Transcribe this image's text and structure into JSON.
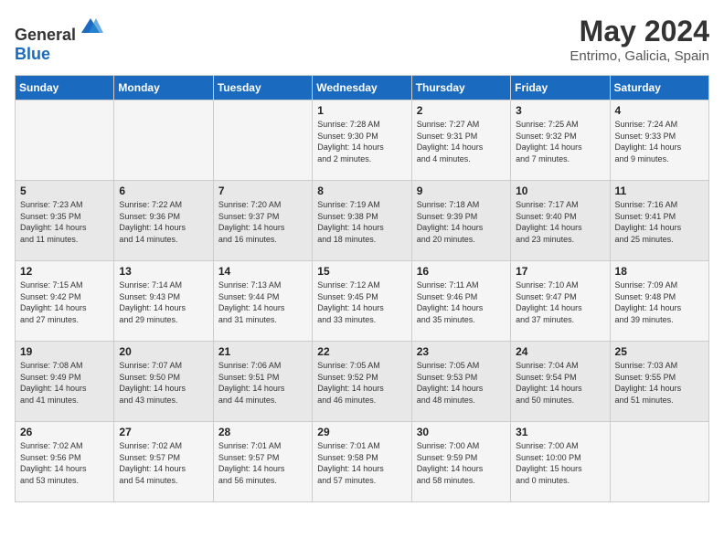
{
  "header": {
    "logo_general": "General",
    "logo_blue": "Blue",
    "month": "May 2024",
    "location": "Entrimo, Galicia, Spain"
  },
  "days_of_week": [
    "Sunday",
    "Monday",
    "Tuesday",
    "Wednesday",
    "Thursday",
    "Friday",
    "Saturday"
  ],
  "weeks": [
    [
      {
        "day": "",
        "info": ""
      },
      {
        "day": "",
        "info": ""
      },
      {
        "day": "",
        "info": ""
      },
      {
        "day": "1",
        "info": "Sunrise: 7:28 AM\nSunset: 9:30 PM\nDaylight: 14 hours\nand 2 minutes."
      },
      {
        "day": "2",
        "info": "Sunrise: 7:27 AM\nSunset: 9:31 PM\nDaylight: 14 hours\nand 4 minutes."
      },
      {
        "day": "3",
        "info": "Sunrise: 7:25 AM\nSunset: 9:32 PM\nDaylight: 14 hours\nand 7 minutes."
      },
      {
        "day": "4",
        "info": "Sunrise: 7:24 AM\nSunset: 9:33 PM\nDaylight: 14 hours\nand 9 minutes."
      }
    ],
    [
      {
        "day": "5",
        "info": "Sunrise: 7:23 AM\nSunset: 9:35 PM\nDaylight: 14 hours\nand 11 minutes."
      },
      {
        "day": "6",
        "info": "Sunrise: 7:22 AM\nSunset: 9:36 PM\nDaylight: 14 hours\nand 14 minutes."
      },
      {
        "day": "7",
        "info": "Sunrise: 7:20 AM\nSunset: 9:37 PM\nDaylight: 14 hours\nand 16 minutes."
      },
      {
        "day": "8",
        "info": "Sunrise: 7:19 AM\nSunset: 9:38 PM\nDaylight: 14 hours\nand 18 minutes."
      },
      {
        "day": "9",
        "info": "Sunrise: 7:18 AM\nSunset: 9:39 PM\nDaylight: 14 hours\nand 20 minutes."
      },
      {
        "day": "10",
        "info": "Sunrise: 7:17 AM\nSunset: 9:40 PM\nDaylight: 14 hours\nand 23 minutes."
      },
      {
        "day": "11",
        "info": "Sunrise: 7:16 AM\nSunset: 9:41 PM\nDaylight: 14 hours\nand 25 minutes."
      }
    ],
    [
      {
        "day": "12",
        "info": "Sunrise: 7:15 AM\nSunset: 9:42 PM\nDaylight: 14 hours\nand 27 minutes."
      },
      {
        "day": "13",
        "info": "Sunrise: 7:14 AM\nSunset: 9:43 PM\nDaylight: 14 hours\nand 29 minutes."
      },
      {
        "day": "14",
        "info": "Sunrise: 7:13 AM\nSunset: 9:44 PM\nDaylight: 14 hours\nand 31 minutes."
      },
      {
        "day": "15",
        "info": "Sunrise: 7:12 AM\nSunset: 9:45 PM\nDaylight: 14 hours\nand 33 minutes."
      },
      {
        "day": "16",
        "info": "Sunrise: 7:11 AM\nSunset: 9:46 PM\nDaylight: 14 hours\nand 35 minutes."
      },
      {
        "day": "17",
        "info": "Sunrise: 7:10 AM\nSunset: 9:47 PM\nDaylight: 14 hours\nand 37 minutes."
      },
      {
        "day": "18",
        "info": "Sunrise: 7:09 AM\nSunset: 9:48 PM\nDaylight: 14 hours\nand 39 minutes."
      }
    ],
    [
      {
        "day": "19",
        "info": "Sunrise: 7:08 AM\nSunset: 9:49 PM\nDaylight: 14 hours\nand 41 minutes."
      },
      {
        "day": "20",
        "info": "Sunrise: 7:07 AM\nSunset: 9:50 PM\nDaylight: 14 hours\nand 43 minutes."
      },
      {
        "day": "21",
        "info": "Sunrise: 7:06 AM\nSunset: 9:51 PM\nDaylight: 14 hours\nand 44 minutes."
      },
      {
        "day": "22",
        "info": "Sunrise: 7:05 AM\nSunset: 9:52 PM\nDaylight: 14 hours\nand 46 minutes."
      },
      {
        "day": "23",
        "info": "Sunrise: 7:05 AM\nSunset: 9:53 PM\nDaylight: 14 hours\nand 48 minutes."
      },
      {
        "day": "24",
        "info": "Sunrise: 7:04 AM\nSunset: 9:54 PM\nDaylight: 14 hours\nand 50 minutes."
      },
      {
        "day": "25",
        "info": "Sunrise: 7:03 AM\nSunset: 9:55 PM\nDaylight: 14 hours\nand 51 minutes."
      }
    ],
    [
      {
        "day": "26",
        "info": "Sunrise: 7:02 AM\nSunset: 9:56 PM\nDaylight: 14 hours\nand 53 minutes."
      },
      {
        "day": "27",
        "info": "Sunrise: 7:02 AM\nSunset: 9:57 PM\nDaylight: 14 hours\nand 54 minutes."
      },
      {
        "day": "28",
        "info": "Sunrise: 7:01 AM\nSunset: 9:57 PM\nDaylight: 14 hours\nand 56 minutes."
      },
      {
        "day": "29",
        "info": "Sunrise: 7:01 AM\nSunset: 9:58 PM\nDaylight: 14 hours\nand 57 minutes."
      },
      {
        "day": "30",
        "info": "Sunrise: 7:00 AM\nSunset: 9:59 PM\nDaylight: 14 hours\nand 58 minutes."
      },
      {
        "day": "31",
        "info": "Sunrise: 7:00 AM\nSunset: 10:00 PM\nDaylight: 15 hours\nand 0 minutes."
      },
      {
        "day": "",
        "info": ""
      }
    ]
  ]
}
